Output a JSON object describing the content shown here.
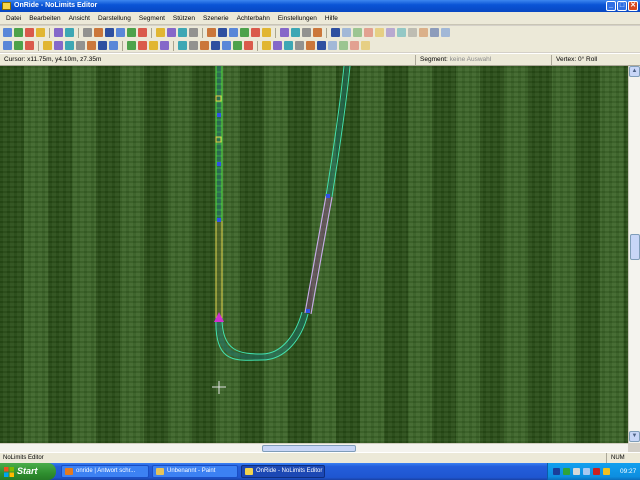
{
  "window": {
    "title": "OnRide - NoLimits Editor",
    "controls": [
      "_",
      "□",
      "✕"
    ]
  },
  "menu": [
    "Datei",
    "Bearbeiten",
    "Ansicht",
    "Darstellung",
    "Segment",
    "Stützen",
    "Szenerie",
    "Achterbahn",
    "Einstellungen",
    "Hilfe"
  ],
  "toolbar_row1": [
    "new-icon",
    "open-icon",
    "save-icon",
    "cut-icon",
    "undo-icon",
    "redo-icon",
    "track-icon",
    "track-down-icon",
    "track-up-icon",
    "track-flat-icon",
    "car-icon",
    "train-icon",
    "split-icon",
    "move-icon",
    "add-icon",
    "cross-icon",
    "camera-icon",
    "page-icon",
    "cube-icon",
    "photo-icon",
    "prev-icon",
    "next-icon",
    "warning-icon",
    "render-icon",
    "page2-icon",
    "stop-icon",
    "film-icon",
    "play-icon",
    "c1-icon",
    "c2-icon",
    "c3-icon",
    "c4-icon",
    "c5-icon",
    "c6-icon",
    "c7-icon",
    "c8-icon",
    "c9-icon"
  ],
  "toolbar_row2": [
    "coaster-icon",
    "paint-icon",
    "connect-icon",
    "support1-icon",
    "support2-icon",
    "support3-icon",
    "support4-icon",
    "support5-icon",
    "support6-icon",
    "support7-icon",
    "terrain1-icon",
    "terrain2-icon",
    "terrain3-icon",
    "grass-icon",
    "support-a-icon",
    "support-b-icon",
    "support-c-icon",
    "support-d-icon",
    "support-e-icon",
    "support-f-icon",
    "support-g-icon",
    "select-icon",
    "mode1-icon",
    "mode2-icon",
    "mode3-icon",
    "mode4-icon",
    "mode5-icon",
    "mode6-icon",
    "mode7-icon",
    "mode8-icon",
    "stop-label-icon"
  ],
  "status_row": {
    "cursor": "Cursor: x11.75m, y4.10m, z7.35m",
    "segment_label": "Segment:",
    "segment_value": "keine Auswahl",
    "vertex": "Vertex: 0° Roll"
  },
  "app_status": {
    "text": "NoLimits Editor",
    "num": "NUM"
  },
  "taskbar": {
    "start": "Start",
    "tasks": [
      {
        "label": "onride | Antwort schr...",
        "icon_color": "#e67a1c"
      },
      {
        "label": "Unbenannt - Paint",
        "icon_color": "#e5c35a"
      },
      {
        "label": "OnRide - NoLimits Editor",
        "icon_color": "#f2d34d"
      }
    ],
    "clock": "09:27"
  },
  "colors": {
    "track_selected": "#c8a8e8",
    "track_normal": "#40e0b0",
    "track_green": "#4be04b",
    "vertex_blue": "#3050e8",
    "vertex_magenta": "#d030d0",
    "grass": "#2f5a1a"
  }
}
